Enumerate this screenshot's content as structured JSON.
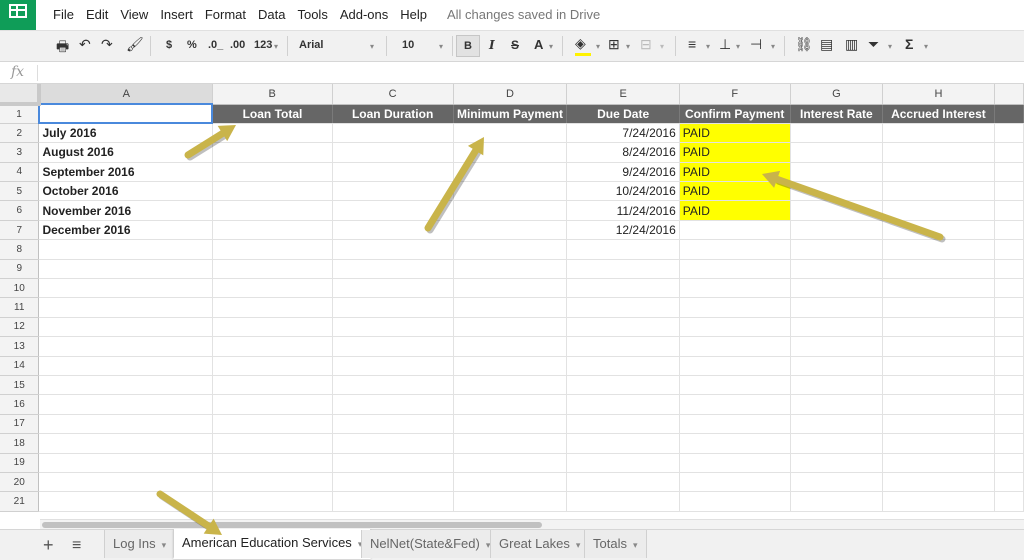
{
  "app": {
    "logo_icon": "sheets-logo-icon",
    "brand_color": "#0f9d58"
  },
  "menu": {
    "items": [
      "File",
      "Edit",
      "View",
      "Insert",
      "Format",
      "Data",
      "Tools",
      "Add-ons",
      "Help"
    ],
    "save_status": "All changes saved in Drive"
  },
  "toolbar": {
    "currency": "$",
    "percent": "%",
    "decrease_decimals": ".0_",
    "increase_decimals": ".00",
    "more_formats": "123",
    "font": "Arial",
    "font_size": "10",
    "bold": "B",
    "italic": "I",
    "strike": "S",
    "text_color": "A",
    "fill_color": "#fff200",
    "sigma": "Σ"
  },
  "formula_bar": {
    "fx": "fx",
    "value": ""
  },
  "sheet": {
    "columns": [
      "A",
      "B",
      "C",
      "D",
      "E",
      "F",
      "G",
      "H"
    ],
    "header_row": [
      "",
      "Loan Total",
      "Loan Duration",
      "Minimum Payment",
      "Due Date",
      "Confirm Payment",
      "Interest Rate",
      "Accrued Interest"
    ],
    "rows": [
      [
        "July 2016",
        "",
        "",
        "",
        "7/24/2016",
        "PAID",
        "",
        ""
      ],
      [
        "August 2016",
        "",
        "",
        "",
        "8/24/2016",
        "PAID",
        "",
        ""
      ],
      [
        "September 2016",
        "",
        "",
        "",
        "9/24/2016",
        "PAID",
        "",
        ""
      ],
      [
        "October 2016",
        "",
        "",
        "",
        "10/24/2016",
        "PAID",
        "",
        ""
      ],
      [
        "November 2016",
        "",
        "",
        "",
        "11/24/2016",
        "PAID",
        "",
        ""
      ],
      [
        "December 2016",
        "",
        "",
        "",
        "12/24/2016",
        "",
        "",
        ""
      ]
    ],
    "row_numbers": [
      "1",
      "2",
      "3",
      "4",
      "5",
      "6",
      "7",
      "8",
      "9",
      "10",
      "11",
      "12",
      "13",
      "14",
      "15",
      "16",
      "17",
      "18",
      "19",
      "20",
      "21"
    ],
    "header_fill": "#666666",
    "paid_fill": "#ffff00",
    "selected_cell": "A1"
  },
  "tabs": {
    "add_label": "+",
    "list_label": "≡",
    "items": [
      {
        "label": "Log Ins",
        "active": false
      },
      {
        "label": "American Education Services",
        "active": true
      },
      {
        "label": "NelNet(State&Fed)",
        "active": false
      },
      {
        "label": "Great Lakes",
        "active": false
      },
      {
        "label": "Totals",
        "active": false
      }
    ],
    "caret": "▾"
  },
  "annotation": {
    "arrow_color": "#c9b44a"
  }
}
